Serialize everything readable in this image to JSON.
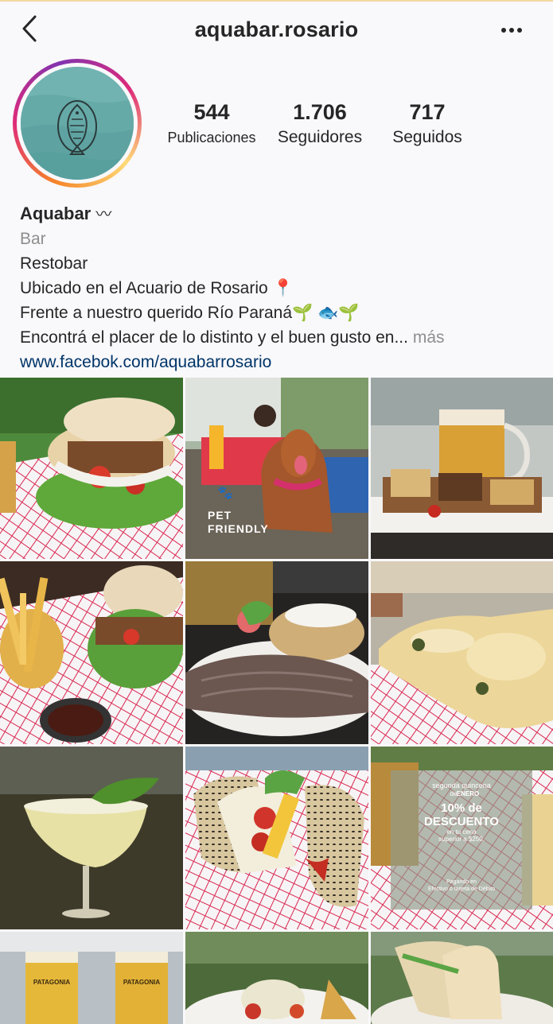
{
  "header": {
    "username": "aquabar.rosario",
    "back_icon": "chevron-left-icon",
    "more_icon": "more-horizontal-icon"
  },
  "stats": [
    {
      "value": "544",
      "label": "Publicaciones"
    },
    {
      "value": "1.706",
      "label": "Seguidores"
    },
    {
      "value": "717",
      "label": "Seguidos"
    }
  ],
  "bio": {
    "name": "Aquabar",
    "name_suffix": "〰",
    "category": "Bar",
    "lines": [
      "Restobar",
      "Ubicado en el Acuario de Rosario 📍",
      "Frente a nuestro querido Río Paraná🌱 🐟🌱",
      "Encontrá el placer de lo distinto y el buen gusto en..."
    ],
    "more_label": "más",
    "link": "www.facebok.com/aquabarrosario"
  },
  "posts": {
    "pet_friendly_line1": "PET",
    "pet_friendly_line2": "FRIENDLY",
    "promo_top": "segunda quincena",
    "promo_month_pre": "de",
    "promo_month": "ENERO",
    "promo_pct": "10% de",
    "promo_desc": "DESCUENTO",
    "promo_sub1": "en tu cena",
    "promo_sub2": "superior a $250.",
    "promo_pay1": "Pagando en",
    "promo_pay2": "Efectivo o tarjeta de Débito",
    "beer_label": "PATAGONIA"
  }
}
